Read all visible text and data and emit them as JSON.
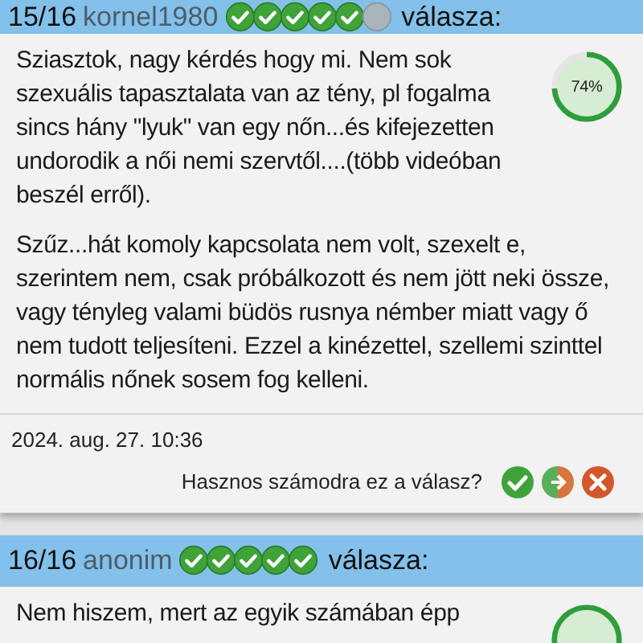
{
  "answers": [
    {
      "header": {
        "index": "15/16",
        "author": "kornel1980",
        "badges": [
          {
            "earned": true
          },
          {
            "earned": true
          },
          {
            "earned": true
          },
          {
            "earned": true
          },
          {
            "earned": true
          },
          {
            "earned": false
          }
        ],
        "suffix": "válasza:"
      },
      "rating": {
        "label": "74%",
        "level": 0.74
      },
      "paragraphs": [
        "Sziasztok, nagy kérdés hogy mi. Nem sok szexuális tapasztalata van az tény, pl fogalma sincs hány \"lyuk\" van egy nőn...és kifejezetten undorodik a női nemi szervtől....(több videóban beszél erről).",
        "Szűz...hát komoly kapcsolata nem volt, szexelt e, szerintem nem, csak próbálkozott és nem jött neki össze, vagy tényleg valami büdös rusnya némber miatt vagy ő nem tudott teljesíteni. Ezzel a kinézettel, szellemi szinttel normális nőnek sosem fog kelleni."
      ],
      "date": "2024. aug. 27. 10:36",
      "question": "Hasznos számodra ez a válasz?"
    },
    {
      "header": {
        "index": "16/16",
        "author": "anonim",
        "badges": [
          {
            "earned": true
          },
          {
            "earned": true
          },
          {
            "earned": true
          },
          {
            "earned": true
          },
          {
            "earned": true
          }
        ],
        "suffix": "válasza:"
      },
      "paragraphs": [
        "Nem hiszem, mert az egyik számában épp"
      ]
    }
  ]
}
